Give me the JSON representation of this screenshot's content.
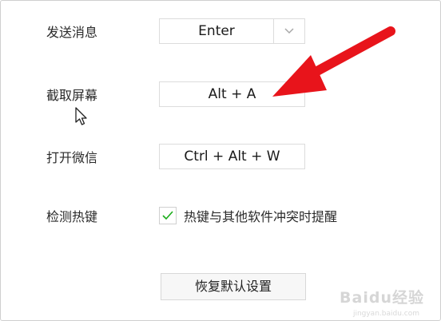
{
  "settings": {
    "send_message": {
      "label": "发送消息",
      "value": "Enter"
    },
    "screenshot": {
      "label": "截取屏幕",
      "value": "Alt + A"
    },
    "open_wechat": {
      "label": "打开微信",
      "value": "Ctrl + Alt + W"
    },
    "detect_hotkey": {
      "label": "检测热键",
      "checkbox_label": "热键与其他软件冲突时提醒",
      "checked": true
    },
    "reset_button": "恢复默认设置"
  },
  "watermark": {
    "title": "Baidu经验",
    "url": "jingyan.baidu.com"
  },
  "colors": {
    "annotation_arrow": "#e8141b",
    "checkmark": "#1aad19"
  },
  "icons": [
    "chevron-down-icon",
    "checkmark-icon",
    "mouse-cursor-icon",
    "red-arrow-annotation"
  ]
}
